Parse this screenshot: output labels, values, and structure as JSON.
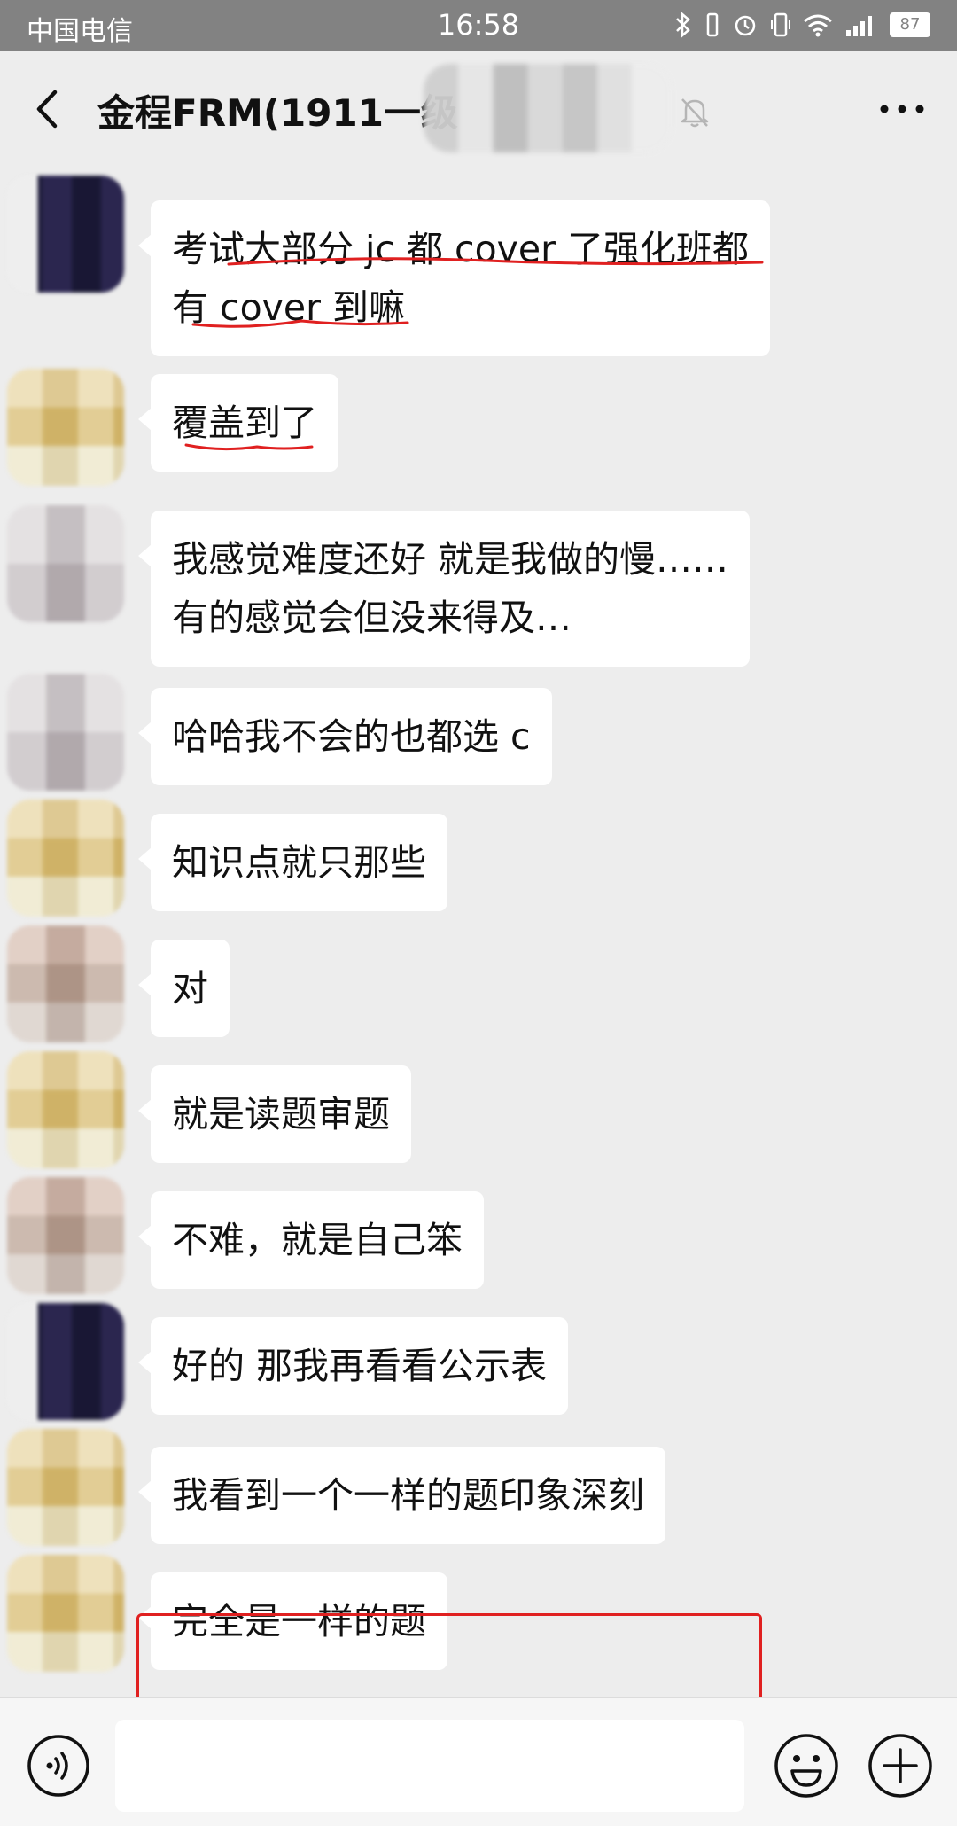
{
  "status_bar": {
    "carrier": "中国电信",
    "time": "16:58",
    "battery": "87",
    "icons": [
      "bluetooth-icon",
      "vibrate-icon",
      "alarm-icon",
      "phone-icon",
      "wifi-icon",
      "signal-icon",
      "battery-icon"
    ]
  },
  "header": {
    "title": "金程FRM(1911一级",
    "back_icon": "chevron-left-icon",
    "mute_icon": "bell-off-icon",
    "more_icon": "more-dots-icon"
  },
  "messages": [
    {
      "avatar": "dark",
      "lines": [
        "考试大部分 jc 都 cover 了强化班都",
        "有 cover 到嘛"
      ]
    },
    {
      "avatar": "gold",
      "lines": [
        "覆盖到了"
      ]
    },
    {
      "avatar": "gray",
      "lines": [
        "我感觉难度还好 就是我做的慢……",
        "有的感觉会但没来得及…"
      ]
    },
    {
      "avatar": "gray",
      "lines": [
        "哈哈我不会的也都选 c"
      ]
    },
    {
      "avatar": "gold",
      "lines": [
        "知识点就只那些"
      ]
    },
    {
      "avatar": "tan",
      "lines": [
        "对"
      ]
    },
    {
      "avatar": "gold",
      "lines": [
        "就是读题审题"
      ]
    },
    {
      "avatar": "tan",
      "lines": [
        "不难，就是自己笨"
      ]
    },
    {
      "avatar": "dark",
      "lines": [
        "好的 那我再看看公示表"
      ]
    },
    {
      "avatar": "gold",
      "lines": [
        "我看到一个一样的题印象深刻"
      ]
    },
    {
      "avatar": "gold",
      "lines": [
        "完全是一样的题"
      ]
    }
  ],
  "input_bar": {
    "voice_icon": "voice-icon",
    "emoji_icon": "emoji-icon",
    "plus_icon": "plus-icon",
    "input_value": ""
  },
  "colors": {
    "status_bar_bg": "#828282",
    "chat_bg": "#ededed",
    "bubble_bg": "#ffffff",
    "annotation_red": "#e02020"
  }
}
